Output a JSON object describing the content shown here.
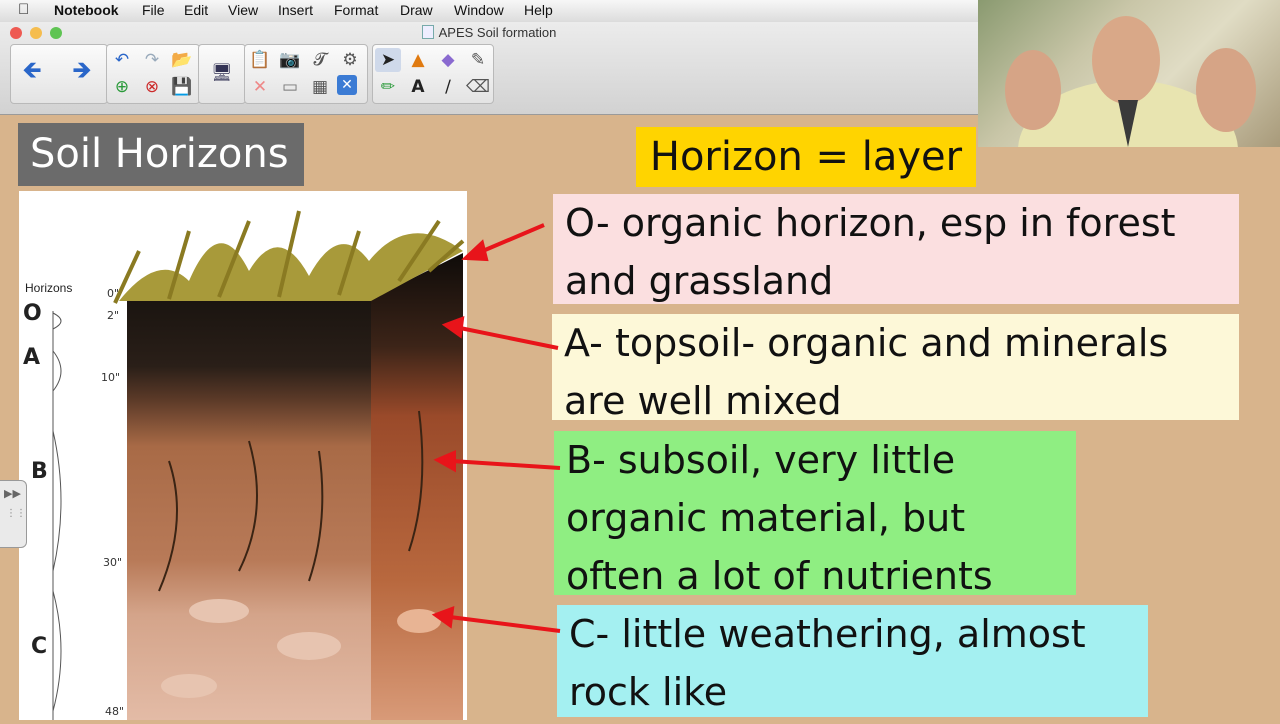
{
  "menubar": {
    "apple": "",
    "items": [
      "Notebook",
      "File",
      "Edit",
      "View",
      "Insert",
      "Format",
      "Draw",
      "Window",
      "Help"
    ]
  },
  "window": {
    "title": "APES Soil formation"
  },
  "slide": {
    "title": "Soil Horizons",
    "definition": "Horizon = layer",
    "horizons": [
      {
        "letter": "O",
        "lines": [
          "O- organic horizon, esp in forest",
          "and grassland"
        ]
      },
      {
        "letter": "A",
        "lines": [
          "A- topsoil- organic and minerals",
          "are well mixed"
        ]
      },
      {
        "letter": "B",
        "lines": [
          "B- subsoil, very little",
          "organic material, but",
          "often a lot of nutrients"
        ]
      },
      {
        "letter": "C",
        "lines": [
          "C- little weathering, almost",
          "rock like"
        ]
      }
    ],
    "figure": {
      "heading": "Horizons",
      "letters": [
        "O",
        "A",
        "B",
        "C"
      ],
      "depths": [
        "0\"",
        "2\"",
        "10\"",
        "30\"",
        "48\""
      ]
    }
  },
  "colors": {
    "canvas": "#d8b48c",
    "title_bg": "#6b6b6b",
    "definition_bg": "#ffd400",
    "o_box": "#fbdfe0",
    "a_box": "#fdf8d8",
    "b_box": "#8fee82",
    "c_box": "#a4f0f1",
    "arrow": "#e8141a"
  },
  "icons": [
    "back-arrow-icon",
    "forward-arrow-icon",
    "undo-icon",
    "redo-icon",
    "open-icon",
    "add-page-icon",
    "delete-page-icon",
    "save-icon",
    "screen-shade-icon",
    "paste-icon",
    "screen-capture-icon",
    "table-icon",
    "delete-icon",
    "select-icon",
    "shapes-icon",
    "fill-icon",
    "pen-icon",
    "text-icon",
    "line-icon",
    "eraser-icon"
  ]
}
